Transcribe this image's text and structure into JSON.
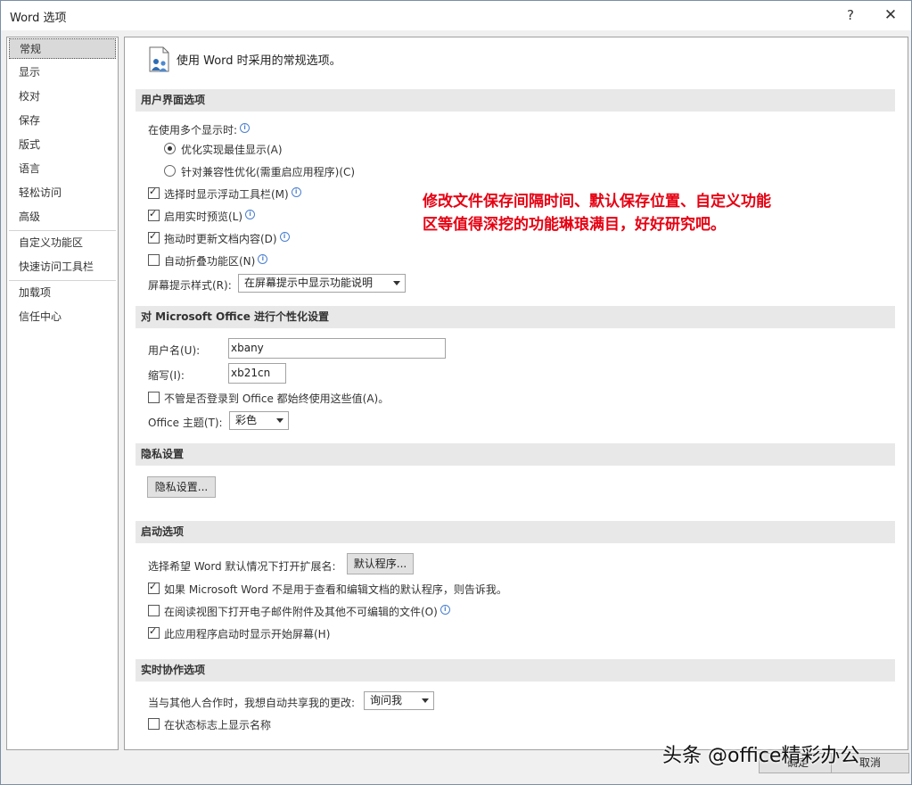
{
  "window": {
    "title": "Word 选项",
    "help": "?",
    "close": "✕"
  },
  "nav": {
    "items": [
      "常规",
      "显示",
      "校对",
      "保存",
      "版式",
      "语言",
      "轻松访问",
      "高级",
      "自定义功能区",
      "快速访问工具栏",
      "加载项",
      "信任中心"
    ],
    "selected": "常规"
  },
  "header": {
    "text": "使用 Word 时采用的常规选项。",
    "icon": "general-options-icon"
  },
  "ui_options": {
    "title": "用户界面选项",
    "multi_display_label": "在使用多个显示时:",
    "radio_optimize": "优化实现最佳显示(A)",
    "radio_compat": "针对兼容性优化(需重启应用程序)(C)",
    "mini_toolbar": "选择时显示浮动工具栏(M)",
    "live_preview": "启用实时预览(L)",
    "update_drag": "拖动时更新文档内容(D)",
    "collapse_ribbon": "自动折叠功能区(N)",
    "screentip_label": "屏幕提示样式(R):",
    "screentip_value": "在屏幕提示中显示功能说明"
  },
  "personalize": {
    "title": "对 Microsoft Office 进行个性化设置",
    "username_label": "用户名(U):",
    "username_value": "xbany",
    "initials_label": "缩写(I):",
    "initials_value": "xb21cn",
    "always_use": "不管是否登录到 Office 都始终使用这些值(A)。",
    "theme_label": "Office 主题(T):",
    "theme_value": "彩色"
  },
  "privacy": {
    "title": "隐私设置",
    "button": "隐私设置..."
  },
  "startup": {
    "title": "启动选项",
    "default_label": "选择希望 Word 默认情况下打开扩展名:",
    "default_button": "默认程序...",
    "tell_me": "如果 Microsoft Word 不是用于查看和编辑文档的默认程序，则告诉我。",
    "reading_view": "在阅读视图下打开电子邮件附件及其他不可编辑的文件(O)",
    "start_screen": "此应用程序启动时显示开始屏幕(H)"
  },
  "coauth": {
    "title": "实时协作选项",
    "share_label": "当与其他人合作时，我想自动共享我的更改:",
    "share_value": "询问我",
    "show_names": "在状态标志上显示名称"
  },
  "annotation": {
    "line1": "修改文件保存间隔时间、默认保存位置、自定义功能",
    "line2": "区等值得深挖的功能琳琅满目，好好研究吧。"
  },
  "footer": {
    "ok": "确定",
    "cancel": "取消"
  },
  "watermark": "头条 @office精彩办公"
}
